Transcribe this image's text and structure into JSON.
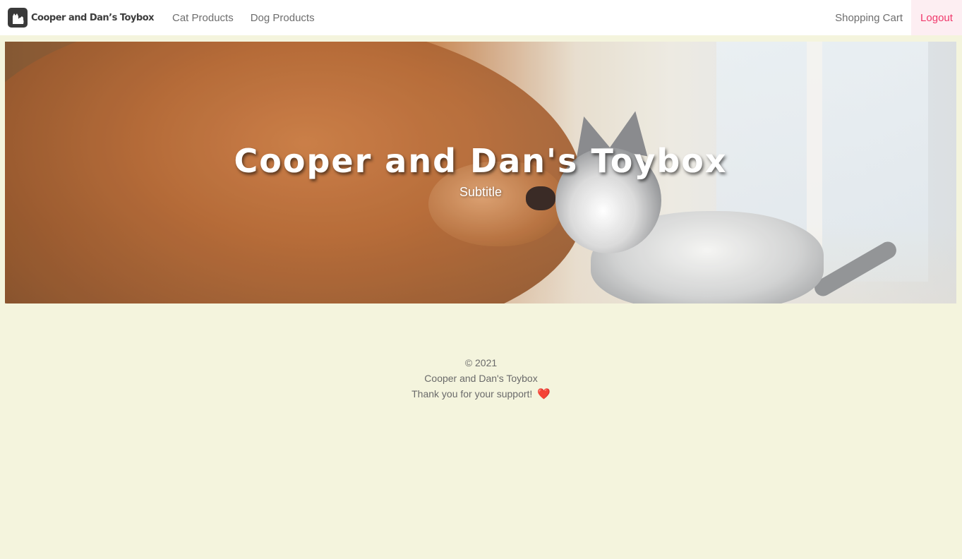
{
  "navbar": {
    "brand_text": "Cooper and Dan’s Toybox",
    "links": {
      "cat_products": "Cat Products",
      "dog_products": "Dog Products",
      "shopping_cart": "Shopping Cart",
      "logout": "Logout"
    },
    "accent_color": "#f0386b"
  },
  "hero": {
    "title": "Cooper and Dan's Toybox",
    "subtitle": "Subtitle"
  },
  "footer": {
    "copyright": "© 2021",
    "company": "Cooper and Dan's Toybox",
    "thanks": "Thank you for your support!",
    "heart_icon": "❤️"
  },
  "colors": {
    "page_background": "#f4f4dd",
    "navbar_background": "#ffffff",
    "logout_background": "#fdeef2"
  }
}
